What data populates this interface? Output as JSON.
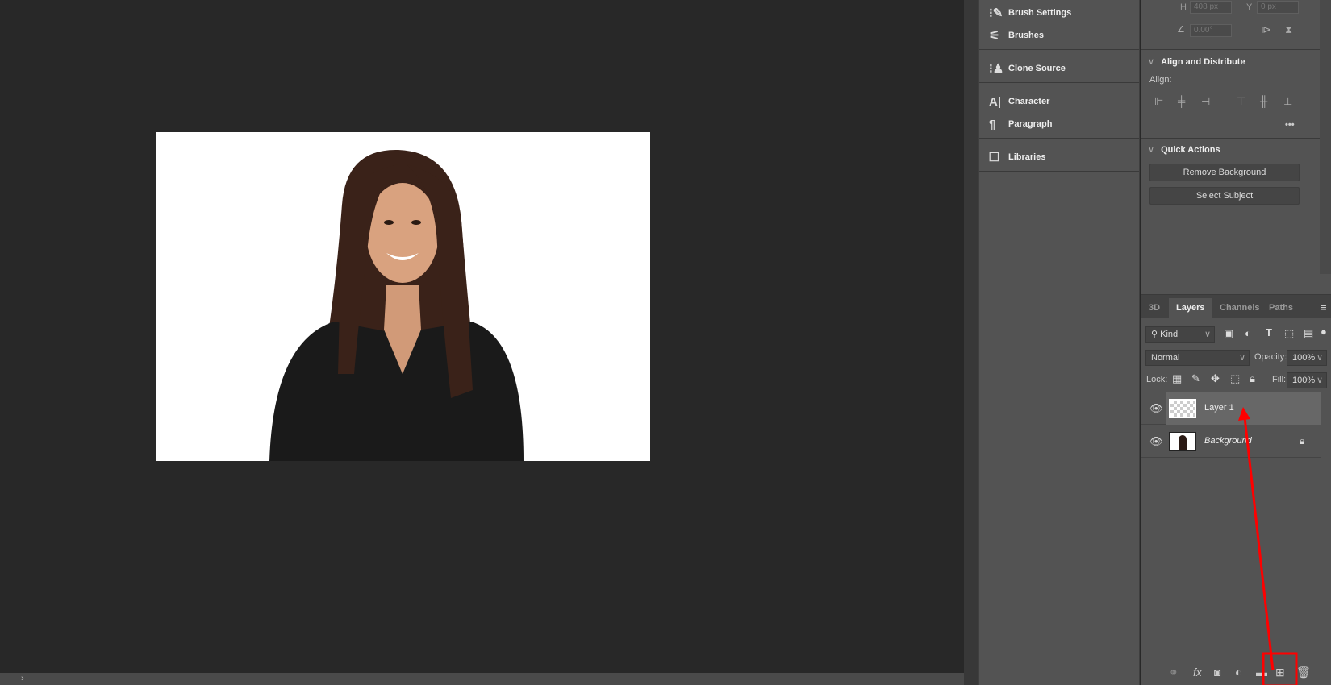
{
  "canvas": {
    "status_chevron": "›"
  },
  "middle_panel": {
    "items": [
      {
        "label": "Brush Settings",
        "icon": "brush-settings-icon",
        "glyph": "⁝✎"
      },
      {
        "label": "Brushes",
        "icon": "brushes-icon",
        "glyph": "⚟"
      },
      {
        "label": "Clone Source",
        "icon": "clone-source-icon",
        "glyph": "⁝♟"
      },
      {
        "label": "Character",
        "icon": "character-icon",
        "glyph": "A|"
      },
      {
        "label": "Paragraph",
        "icon": "paragraph-icon",
        "glyph": "¶"
      },
      {
        "label": "Libraries",
        "icon": "libraries-icon",
        "glyph": "❐"
      }
    ]
  },
  "properties": {
    "h_label": "H",
    "h_value": "408 px",
    "y_label": "Y",
    "y_value": "0 px",
    "angle_value": "0.00°",
    "align": {
      "title": "Align and Distribute",
      "align_label": "Align:",
      "more": "•••"
    },
    "quick_actions": {
      "title": "Quick Actions",
      "remove_background": "Remove Background",
      "select_subject": "Select Subject"
    }
  },
  "layers_panel": {
    "tabs": [
      "3D",
      "Layers",
      "Channels",
      "Paths"
    ],
    "active_tab": "Layers",
    "filter": "Kind",
    "blend_mode": "Normal",
    "opacity_label": "Opacity:",
    "opacity": "100%",
    "lock_label": "Lock:",
    "fill_label": "Fill:",
    "fill": "100%",
    "layers": [
      {
        "name": "Layer 1",
        "selected": true,
        "locked": false
      },
      {
        "name": "Background",
        "selected": false,
        "locked": true
      }
    ]
  },
  "annotation": {
    "color": "#ff0000"
  }
}
